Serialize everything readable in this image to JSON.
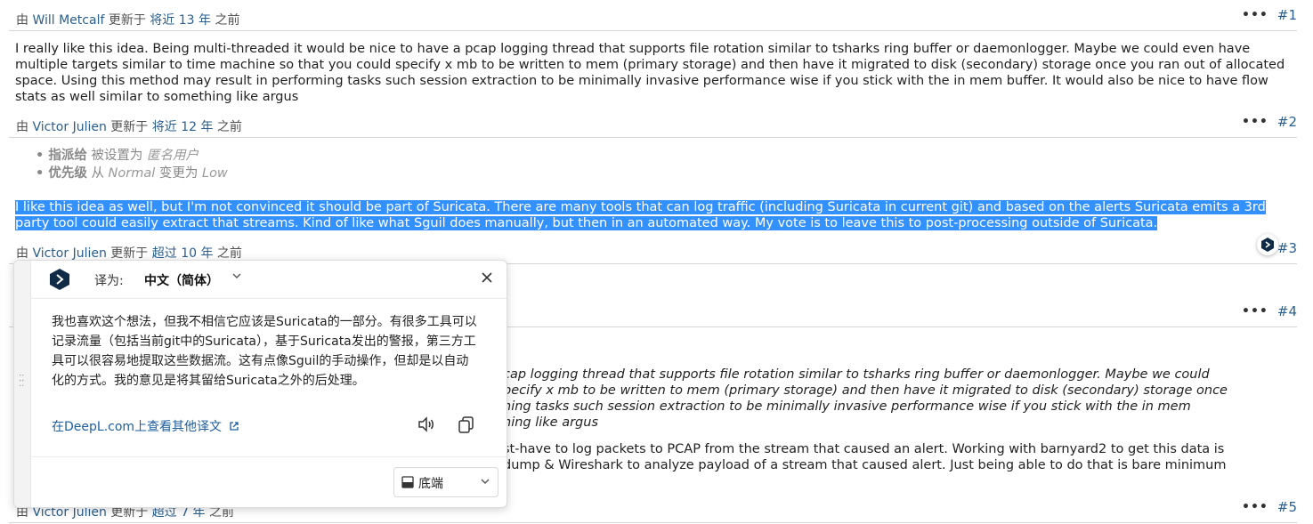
{
  "journals": [
    {
      "by": "由",
      "author": "Will Metcalf",
      "updated": "更新于",
      "ago": "将近 13 年",
      "ago_suffix": "之前",
      "number": "#1",
      "text": "I really like this idea. Being multi-threaded it would be nice to have a pcap logging thread that supports file rotation similar to tsharks ring buffer or daemonlogger. Maybe we could even have multiple targets similar to time machine so that you could specify x mb to be written to mem (primary storage) and then have it migrated to disk (secondary) storage once you ran out of allocated space. Using this method may result in performing tasks such session extraction to be minimally invasive performance wise if you stick with the in mem buffer. It would also be nice to have flow stats as well similar to something like argus"
    },
    {
      "by": "由",
      "author": "Victor Julien",
      "updated": "更新于",
      "ago": "将近 12 年",
      "ago_suffix": "之前",
      "number": "#2",
      "details": [
        {
          "field": "指派给",
          "action": "被设置为",
          "value": "匿名用户"
        },
        {
          "field": "优先级",
          "from_word": "从",
          "from": "Normal",
          "to_word": "变更为",
          "to": "Low"
        }
      ],
      "text": "I like this idea as well, but I'm not convinced it should be part of Suricata. There are many tools that can log traffic (including Suricata in current git) and based on the alerts Suricata emits a 3rd party tool could easily extract that streams. Kind of like what Sguil does manually, but then in an automated way. My vote is to leave this to post-processing outside of Suricata."
    },
    {
      "by": "由",
      "author": "Victor Julien",
      "updated": "更新于",
      "ago": "超过 10 年",
      "ago_suffix": "之前",
      "number": "#3"
    },
    {
      "number": "#4",
      "quote_lines": [
        "cap logging thread that supports file rotation similar to tsharks ring buffer or daemonlogger. Maybe we could",
        "pecify x mb to be written to mem (primary storage) and then have it migrated to disk (secondary) storage once",
        "ning tasks such session extraction to be minimally invasive performance wise if you stick with the in mem",
        "ning like argus"
      ],
      "text_lines": [
        "st-have to log packets to PCAP from the stream that caused an alert. Working with barnyard2 to get this data is",
        "dump & Wireshark to analyze payload of a stream that caused alert. Just being able to do that is bare minimum"
      ]
    },
    {
      "by": "由",
      "author": "Victor Julien",
      "updated": "更新于",
      "ago": "超过 7 年",
      "ago_suffix": "之前",
      "number": "#5"
    }
  ],
  "translator": {
    "label": "译为:",
    "language": "中文（简体）",
    "translation": "我也喜欢这个想法，但我不相信它应该是Suricata的一部分。有很多工具可以记录流量（包括当前git中的Suricata），基于Suricata发出的警报，第三方工具可以很容易地提取这些数据流。这有点像Sguil的手动操作，但却是以自动化的方式。我的意见是将其留给Suricata之外的后处理。",
    "more_link": "在DeepL.com上查看其他译文",
    "position_label": "底端",
    "brand_color": "#0f2b46"
  }
}
